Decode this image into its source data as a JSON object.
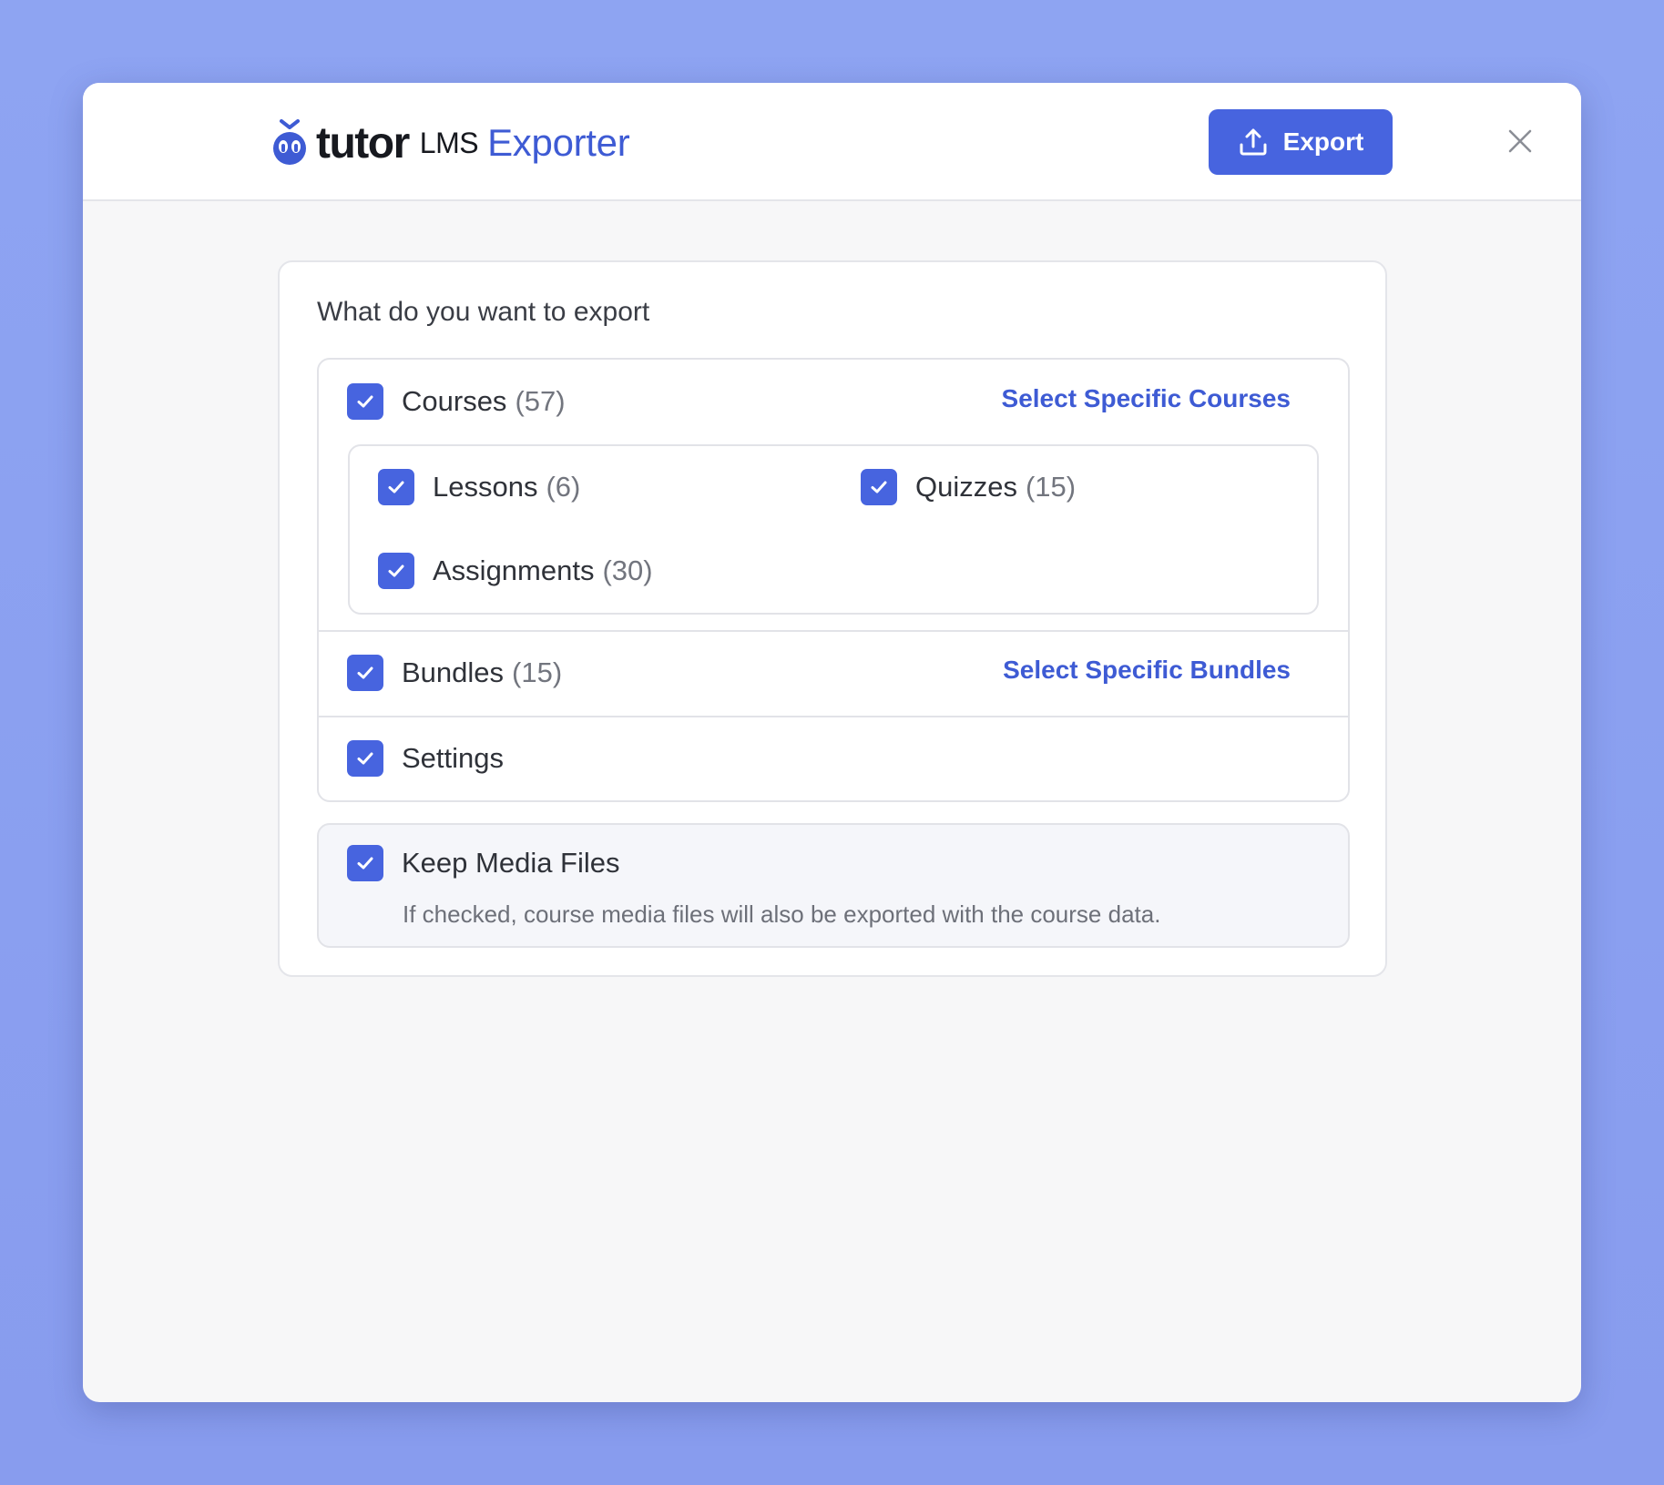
{
  "brand": {
    "logo_word": "tutor",
    "logo_suffix": "LMS",
    "app_name": "Exporter"
  },
  "header": {
    "export_label": "Export",
    "export_icon": "upload-icon",
    "close_icon": "close-icon"
  },
  "export_card": {
    "title": "What do you want to export",
    "courses": {
      "label": "Courses",
      "count": "(57)",
      "checked": true,
      "link": "Select Specific Courses",
      "children": [
        {
          "label": "Lessons",
          "count": "(6)",
          "checked": true
        },
        {
          "label": "Quizzes",
          "count": "(15)",
          "checked": true
        },
        {
          "label": "Assignments",
          "count": "(30)",
          "checked": true
        }
      ]
    },
    "bundles": {
      "label": "Bundles",
      "count": "(15)",
      "checked": true,
      "link": "Select Specific Bundles"
    },
    "settings": {
      "label": "Settings",
      "checked": true
    },
    "media": {
      "label": "Keep Media Files",
      "checked": true,
      "description": "If checked, course media files will also be exported with the course data."
    }
  },
  "colors": {
    "accent": "#4764df",
    "brand_text": "#3e5bd4",
    "background": "#8ea4f2"
  }
}
